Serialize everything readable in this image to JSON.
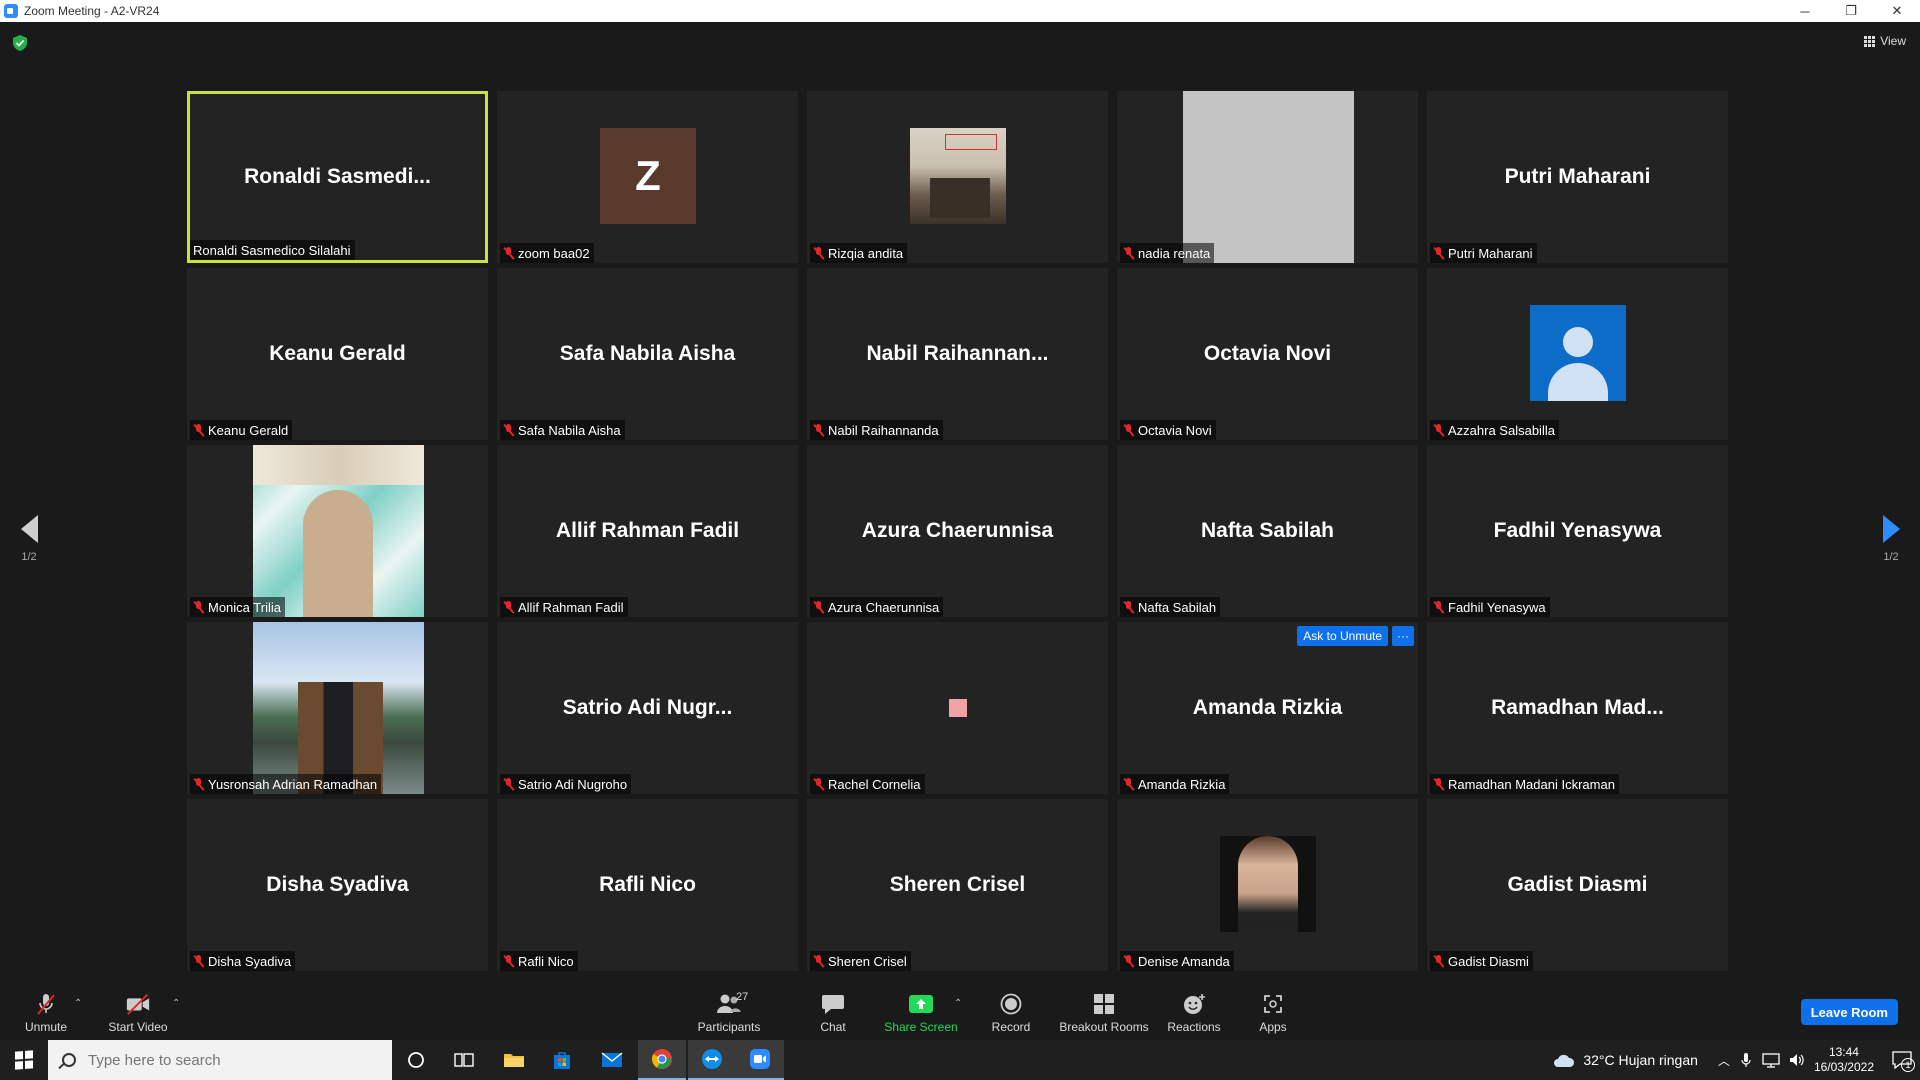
{
  "window": {
    "title": "Zoom Meeting - A2-VR24",
    "controls": [
      "─",
      "❐",
      "✕"
    ]
  },
  "meeting": {
    "view_label": "View",
    "ask_unmute_label": "Ask to Unmute",
    "more_label": "···",
    "page_left": "1/2",
    "page_right": "1/2"
  },
  "tiles": [
    {
      "display": "Ronaldi  Sasmedi...",
      "label": "Ronaldi Sasmedico Silalahi",
      "kind": "name",
      "muted": false,
      "active": true
    },
    {
      "display": "Z",
      "label": "zoom baa02",
      "kind": "letter",
      "muted": true
    },
    {
      "display": "",
      "label": "Rizqia andita",
      "kind": "photo-shop",
      "muted": true
    },
    {
      "display": "",
      "label": "nadia renata",
      "kind": "photo-grey",
      "muted": true
    },
    {
      "display": "Putri Maharani",
      "label": "Putri Maharani",
      "kind": "name",
      "muted": true
    },
    {
      "display": "Keanu Gerald",
      "label": "Keanu Gerald",
      "kind": "name",
      "muted": true
    },
    {
      "display": "Safa Nabila Aisha",
      "label": "Safa Nabila Aisha",
      "kind": "name",
      "muted": true
    },
    {
      "display": "Nabil  Raihannan...",
      "label": "Nabil Raihannanda",
      "kind": "name",
      "muted": true
    },
    {
      "display": "Octavia Novi",
      "label": "Octavia Novi",
      "kind": "name",
      "muted": true
    },
    {
      "display": "",
      "label": "Azzahra Salsabilla",
      "kind": "photo-default",
      "muted": true
    },
    {
      "display": "",
      "label": "Monica Trilia",
      "kind": "photo-hijab",
      "muted": true
    },
    {
      "display": "Allif Rahman Fadil",
      "label": "Allif Rahman Fadil",
      "kind": "name",
      "muted": true
    },
    {
      "display": "Azura Chaerunnisa",
      "label": "Azura Chaerunnisa",
      "kind": "name",
      "muted": true
    },
    {
      "display": "Nafta Sabilah",
      "label": "Nafta Sabilah",
      "kind": "name",
      "muted": true
    },
    {
      "display": "Fadhil Yenasywa",
      "label": "Fadhil Yenasywa",
      "kind": "name",
      "muted": true
    },
    {
      "display": "",
      "label": "Yusronsah Adrian Ramadhan",
      "kind": "photo-group",
      "muted": true
    },
    {
      "display": "Satrio  Adi  Nugr...",
      "label": "Satrio Adi Nugroho",
      "kind": "name",
      "muted": true
    },
    {
      "display": "",
      "label": "Rachel Cornelia",
      "kind": "photo-pink",
      "muted": true
    },
    {
      "display": "Amanda Rizkia",
      "label": "Amanda Rizkia",
      "kind": "name",
      "muted": true,
      "hover": true
    },
    {
      "display": "Ramadhan  Mad...",
      "label": "Ramadhan Madani Ickraman",
      "kind": "name",
      "muted": true
    },
    {
      "display": "Disha Syadiva",
      "label": "Disha Syadiva",
      "kind": "name",
      "muted": true
    },
    {
      "display": "Rafli Nico",
      "label": "Rafli Nico",
      "kind": "name",
      "muted": true
    },
    {
      "display": "Sheren Crisel",
      "label": "Sheren Crisel",
      "kind": "name",
      "muted": true
    },
    {
      "display": "",
      "label": "Denise Amanda",
      "kind": "photo-woman",
      "muted": true
    },
    {
      "display": "Gadist Diasmi",
      "label": "Gadist Diasmi",
      "kind": "name",
      "muted": true
    }
  ],
  "toolbar": {
    "unmute": "Unmute",
    "start_video": "Start Video",
    "participants": "Participants",
    "participants_count": "27",
    "chat": "Chat",
    "share_screen": "Share Screen",
    "record": "Record",
    "breakout": "Breakout Rooms",
    "reactions": "Reactions",
    "apps": "Apps",
    "leave": "Leave Room",
    "share_color": "#23d959"
  },
  "taskbar": {
    "search_placeholder": "Type here to search",
    "weather": "32°C  Hujan ringan",
    "time": "13:44",
    "date": "16/03/2022",
    "notif_count": "1"
  }
}
